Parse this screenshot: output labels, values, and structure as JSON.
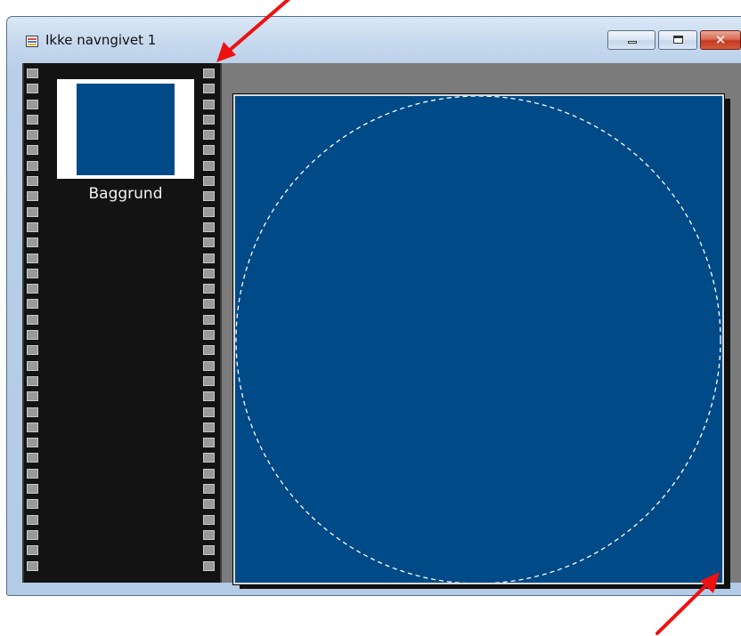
{
  "window": {
    "title": "Ikke navngivet 1",
    "buttons": {
      "minimize": "minimize",
      "maximize": "maximize",
      "close": "x"
    }
  },
  "layers": [
    {
      "name": "Baggrund",
      "color": "#004a87"
    }
  ],
  "canvas": {
    "background_color": "#004a87",
    "selection": "circle-marquee"
  },
  "annotations": {
    "arrow_color": "#ee1111",
    "arrows": [
      "arrow-top-pointing-to-filmstrip-corner",
      "arrow-bottom-pointing-to-canvas-corner"
    ]
  }
}
